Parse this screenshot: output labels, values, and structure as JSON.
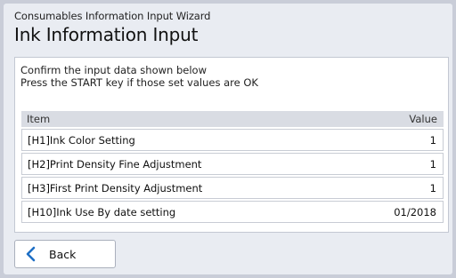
{
  "wizard": {
    "title": "Consumables Information Input Wizard",
    "page_title": "Ink Information Input"
  },
  "instructions": {
    "line1": "Confirm the input data shown below",
    "line2": "Press the START key if those set values are OK"
  },
  "table": {
    "columns": {
      "item": "Item",
      "value": "Value"
    },
    "rows": [
      {
        "item": "[H1]Ink Color Setting",
        "value": "1"
      },
      {
        "item": "[H2]Print Density Fine Adjustment",
        "value": "1"
      },
      {
        "item": "[H3]First Print Density Adjustment",
        "value": "1"
      },
      {
        "item": "[H10]Ink Use By date setting",
        "value": "01/2018"
      }
    ]
  },
  "buttons": {
    "back_label": "Back"
  },
  "icons": {
    "back": "chevron-left-icon"
  },
  "colors": {
    "background": "#c9cdd8",
    "window": "#e9ecf2",
    "table_header": "#d9dce3",
    "back_arrow": "#1f6fc5"
  }
}
